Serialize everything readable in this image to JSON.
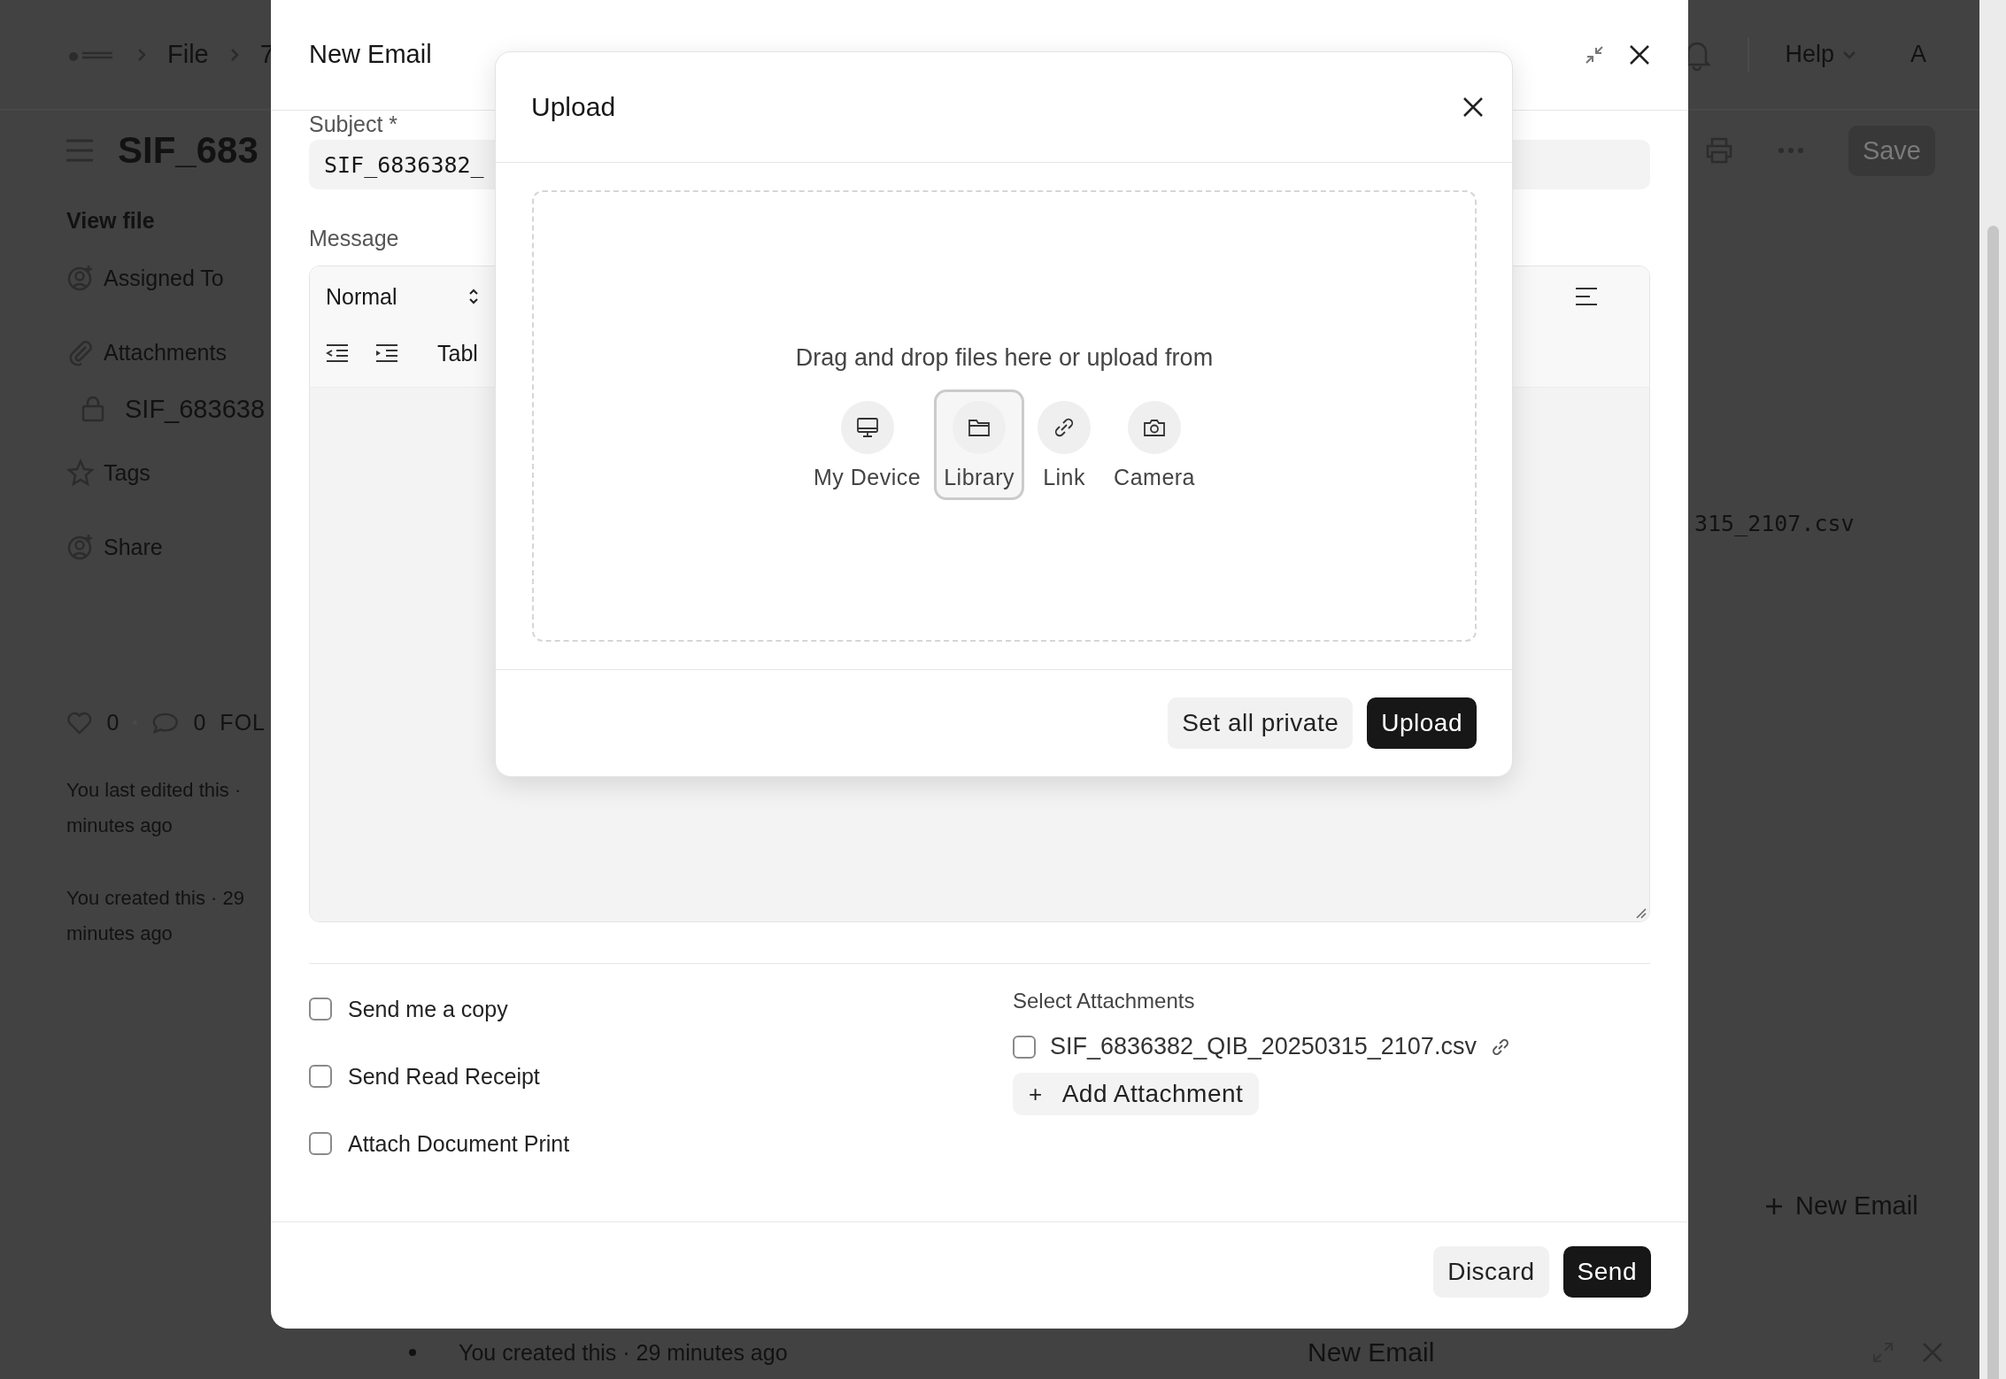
{
  "page": {
    "breadcrumb": [
      {
        "label": "File"
      },
      {
        "label": "7"
      }
    ],
    "help": "Help",
    "avatar": "A",
    "title": "SIF_683",
    "save": "Save",
    "sidebar": {
      "heading": "View file",
      "items": [
        {
          "label": "Assigned To",
          "kind": "assign"
        },
        {
          "label": "Attachments",
          "kind": "attachment",
          "children": [
            {
              "label": "SIF_683638",
              "kind": "file"
            }
          ]
        },
        {
          "label": "Tags",
          "kind": "tag"
        },
        {
          "label": "Share",
          "kind": "share"
        }
      ]
    },
    "likes": "0",
    "comments": "0",
    "follow": "FOL",
    "activity": [
      {
        "lines": [
          "You last edited this ·",
          "minutes ago"
        ]
      },
      {
        "lines": [
          "You created this · 29",
          "minutes ago"
        ]
      }
    ],
    "attachment_name": "315_2107.csv",
    "new_email": "New Email",
    "timeline": "You created this · 29 minutes ago",
    "minimized_title": "New Email"
  },
  "email_dialog": {
    "title": "New Email",
    "subject_label": "Subject *",
    "subject": "SIF_6836382_",
    "message_label": "Message",
    "toolbar": {
      "block_style": "Normal",
      "table": "Tabl"
    },
    "options": [
      {
        "label": "Send me a copy",
        "checked": false
      },
      {
        "label": "Send Read Receipt",
        "checked": false
      },
      {
        "label": "Attach Document Print",
        "checked": false
      }
    ],
    "attachments_label": "Select Attachments",
    "attachments": [
      {
        "name": "SIF_6836382_QIB_20250315_2107.csv",
        "checked": false
      }
    ],
    "add_attachment": "Add Attachment",
    "add_icon": "+",
    "buttons": {
      "discard": "Discard",
      "send": "Send"
    }
  },
  "upload_dialog": {
    "title": "Upload",
    "prompt": "Drag and drop files here or upload from",
    "sources": [
      {
        "label": "My Device",
        "kind": "device",
        "selected": false
      },
      {
        "label": "Library",
        "kind": "library",
        "selected": true
      },
      {
        "label": "Link",
        "kind": "link",
        "selected": false
      },
      {
        "label": "Camera",
        "kind": "camera",
        "selected": false
      }
    ],
    "buttons": {
      "private": "Set all private",
      "upload": "Upload"
    }
  }
}
